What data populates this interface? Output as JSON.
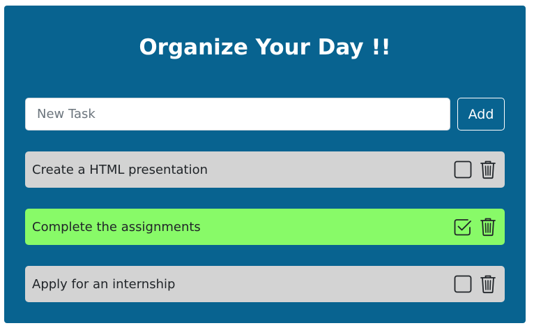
{
  "header": {
    "title": "Organize Your Day !!"
  },
  "input": {
    "placeholder": "New Task",
    "value": ""
  },
  "add_button": {
    "label": "Add"
  },
  "tasks": [
    {
      "text": "Create a HTML presentation",
      "completed": false
    },
    {
      "text": "Complete the assignments",
      "completed": true
    },
    {
      "text": "Apply for an internship",
      "completed": false
    }
  ],
  "icons": {
    "checkbox": "checkbox-icon",
    "checked": "checkbox-checked-icon",
    "delete": "trash-icon"
  },
  "colors": {
    "card_background": "#086390",
    "task_background": "#d3d3d3",
    "task_completed_background": "#88fa68",
    "text": "#212529",
    "white": "#ffffff"
  }
}
